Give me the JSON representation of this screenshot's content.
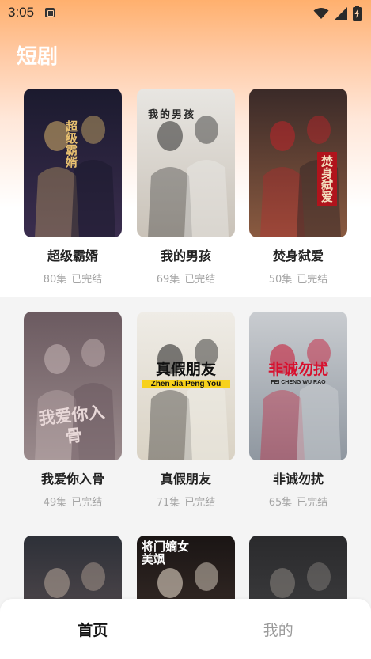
{
  "status_bar": {
    "time": "3:05",
    "notification_icon": "a-box-icon",
    "wifi_icon": "wifi-icon",
    "signal_icon": "signal-icon",
    "battery_icon": "battery-charging-icon"
  },
  "header": {
    "title": "短剧"
  },
  "dramas": [
    {
      "title": "超级霸婿",
      "episodes": "80集",
      "status": "已完结",
      "poster_text": "超级霸婿",
      "colors": [
        "#1b1a2e",
        "#3a2d4e",
        "#d8b36a"
      ]
    },
    {
      "title": "我的男孩",
      "episodes": "69集",
      "status": "已完结",
      "poster_text": "我的男孩",
      "colors": [
        "#e8e6e2",
        "#c9c2b8",
        "#2a2a2a"
      ]
    },
    {
      "title": "焚身弑爱",
      "episodes": "50集",
      "status": "已完结",
      "poster_text": "焚身弑爱",
      "colors": [
        "#3a2a28",
        "#8a5a40",
        "#c0242a"
      ]
    },
    {
      "title": "我爱你入骨",
      "episodes": "49集",
      "status": "已完结",
      "poster_text": "我爱你入骨",
      "colors": [
        "#6b5a60",
        "#9a8a8c",
        "#c9b8b8"
      ]
    },
    {
      "title": "真假朋友",
      "episodes": "71集",
      "status": "已完结",
      "poster_text": "真假朋友",
      "poster_subtext": "Zhen Jia Peng You",
      "colors": [
        "#efece6",
        "#d9d2c4",
        "#1a1a1a"
      ]
    },
    {
      "title": "非诚勿扰",
      "episodes": "65集",
      "status": "已完结",
      "poster_text": "非诚勿扰",
      "poster_subtext": "FEI CHENG WU RAO",
      "colors": [
        "#c9ccd0",
        "#8f97a0",
        "#c8102e"
      ]
    },
    {
      "title": "",
      "episodes": "",
      "status": "",
      "poster_text": "",
      "colors": [
        "#2d3038",
        "#6a5a5a",
        "#b8a79a"
      ]
    },
    {
      "title": "",
      "episodes": "",
      "status": "",
      "poster_text": "将门嫡女美飒",
      "colors": [
        "#1a1514",
        "#4a3a34",
        "#f2e6d6"
      ]
    },
    {
      "title": "",
      "episodes": "",
      "status": "",
      "poster_text": "",
      "colors": [
        "#2a2a2c",
        "#4a4a4c",
        "#8a8580"
      ]
    }
  ],
  "bottom_nav": {
    "tabs": [
      {
        "label": "首页",
        "active": true
      },
      {
        "label": "我的",
        "active": false
      }
    ]
  }
}
